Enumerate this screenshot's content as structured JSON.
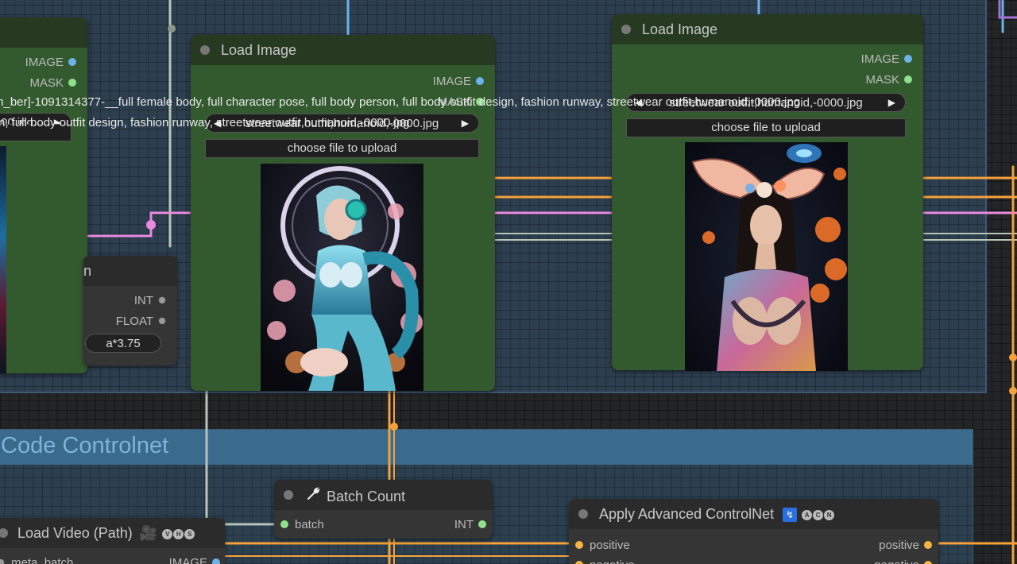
{
  "groups": {
    "bottom_title": "Code Controlnet"
  },
  "node_left": {
    "outputs": [
      "IMAGE",
      "MASK"
    ],
    "combo_value": "00.jpg",
    "combo_value_2": "n, full body outfit design, fashion runwa"
  },
  "node_math": {
    "title_fragment": "n",
    "outputs": [
      "INT",
      "FLOAT"
    ],
    "expression": "a*3.75"
  },
  "node_load_image_1": {
    "title": "Load Image",
    "outputs": [
      "IMAGE",
      "MASK"
    ],
    "image_combo": "streetwear outfit,humanoid,-0000.jpg",
    "upload_label": "choose file to upload"
  },
  "node_load_image_2": {
    "title": "Load Image",
    "outputs": [
      "IMAGE",
      "MASK"
    ],
    "image_combo": "streetwear outfit,humanoid,-0000.jpg",
    "upload_label": "choose file to upload"
  },
  "filename_overlay": "m_ber]-1091314377-__full female body, full character pose, full body person, full body outfit design, fashion runway, streetwear outfit,humanoid,-0000.jpg",
  "filename_overlay_2": "n, full body outfit design, fashion runway, streetwear outfit,humanoid,-0000.jpg",
  "node_batch_count": {
    "title": "Batch Count",
    "input": "batch",
    "output": "INT"
  },
  "node_load_video": {
    "title": "Load Video (Path)",
    "badges": [
      "V",
      "H",
      "S"
    ],
    "row_left": "meta_batch",
    "row_right": "IMAGE"
  },
  "node_apply_controlnet": {
    "title": "Apply Advanced ControlNet",
    "badges": [
      "A",
      "C",
      "N"
    ],
    "input": "positive",
    "output": "positive",
    "input2": "negative",
    "output2": "negative"
  },
  "colors": {
    "canvas_bg": "#222426",
    "group_bg": "#2d3e4e",
    "node_green": "#335a2f",
    "node_dark": "#353535",
    "wire_orange": "#f5a23c",
    "wire_pink": "#e88ae0",
    "wire_gray": "#b8c4b8",
    "wire_blue": "#6fb2ea"
  }
}
